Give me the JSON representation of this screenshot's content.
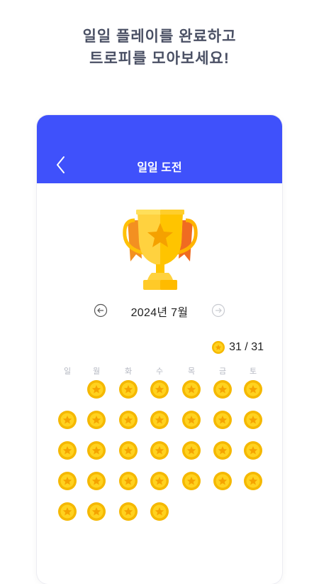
{
  "headline": {
    "line1": "일일 플레이를 완료하고",
    "line2": "트로피를 모아보세요!"
  },
  "appbar": {
    "title": "일일 도전",
    "color": "#3f51fb"
  },
  "month": {
    "label": "2024년 7월"
  },
  "progress": {
    "completed": 31,
    "total": 31,
    "label": "31 / 31"
  },
  "weekdays": [
    "일",
    "월",
    "화",
    "수",
    "목",
    "금",
    "토"
  ],
  "calendar": {
    "first_weekday_index": 1,
    "days_in_month": 31,
    "completed_days": [
      1,
      2,
      3,
      4,
      5,
      6,
      7,
      8,
      9,
      10,
      11,
      12,
      13,
      14,
      15,
      16,
      17,
      18,
      19,
      20,
      21,
      22,
      23,
      24,
      25,
      26,
      27,
      28,
      29,
      30,
      31
    ]
  },
  "icons": {
    "back": "chevron-left-icon",
    "prev_month": "arrow-left-circle-icon",
    "next_month": "arrow-right-circle-icon",
    "coin": "star-coin-icon",
    "trophy": "trophy-icon"
  },
  "colors": {
    "coin_outer": "#f5b800",
    "coin_inner": "#ffd21f",
    "trophy_gold": "#ffca28",
    "ribbon": "#f39021"
  }
}
